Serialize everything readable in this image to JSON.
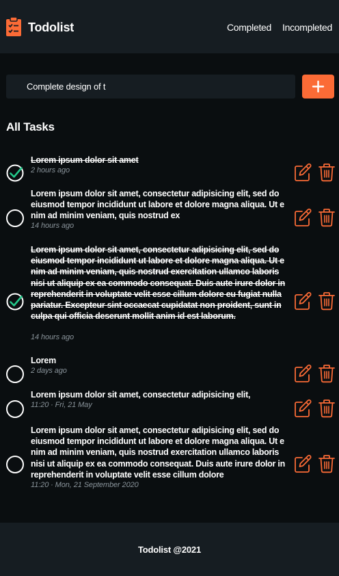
{
  "header": {
    "title": "Todolist",
    "logo_icon": "clipboard-checklist-icon",
    "nav": {
      "completed": "Completed",
      "incompleted": "Incompleted"
    }
  },
  "new_task": {
    "value": "Complete design of t",
    "add_icon": "plus-icon"
  },
  "section_title": "All Tasks",
  "tasks": [
    {
      "text": "Lorem ipsum dolor sit amet",
      "time": "2 hours ago",
      "completed": true
    },
    {
      "text": "Lorem ipsum dolor sit amet, consectetur adipisicing elit, sed do eiusmod tempor incididunt ut labore et dolore magna aliqua. Ut enim ad minim veniam, quis nostrud ex",
      "time": "14 hours ago",
      "completed": false
    },
    {
      "text": "Lorem ipsum dolor sit amet, consectetur adipisicing elit, sed do eiusmod tempor incididunt ut labore et dolore magna aliqua. Ut enim ad minim veniam, quis nostrud exercitation ullamco laboris nisi ut aliquip ex ea commodo consequat. Duis aute irure dolor in reprehenderit in voluptate velit esse cillum dolore eu fugiat nulla pariatur. Excepteur sint occaecat cupidatat non proident, sunt in culpa qui officia deserunt mollit anim id est laborum.",
      "time": "14 hours ago",
      "completed": true
    },
    {
      "text": "Lorem",
      "time": "2 days ago",
      "completed": false
    },
    {
      "text": "Lorem ipsum dolor sit amet, consectetur adipisicing elit,",
      "time": "11:20 · Fri, 21 May",
      "completed": false
    },
    {
      "text": "Lorem ipsum dolor sit amet, consectetur adipisicing elit, sed do eiusmod tempor incididunt ut labore et dolore magna aliqua. Ut enim ad minim veniam, quis nostrud exercitation ullamco laboris nisi ut aliquip ex ea commodo consequat. Duis aute irure dolor in reprehenderit in voluptate velit esse cillum dolore",
      "time": "11:20 · Mon, 21 September 2020",
      "completed": false
    }
  ],
  "task_icons": {
    "checked": "check-circle-icon",
    "unchecked": "empty-circle-icon",
    "edit": "edit-icon",
    "delete": "trash-icon"
  },
  "footer": {
    "text": "Todolist @2021"
  },
  "colors": {
    "accent": "#fb6b36",
    "check": "#23c98a",
    "background": "#0a0e10",
    "panel": "#161d22",
    "muted_text": "#8a949b"
  }
}
